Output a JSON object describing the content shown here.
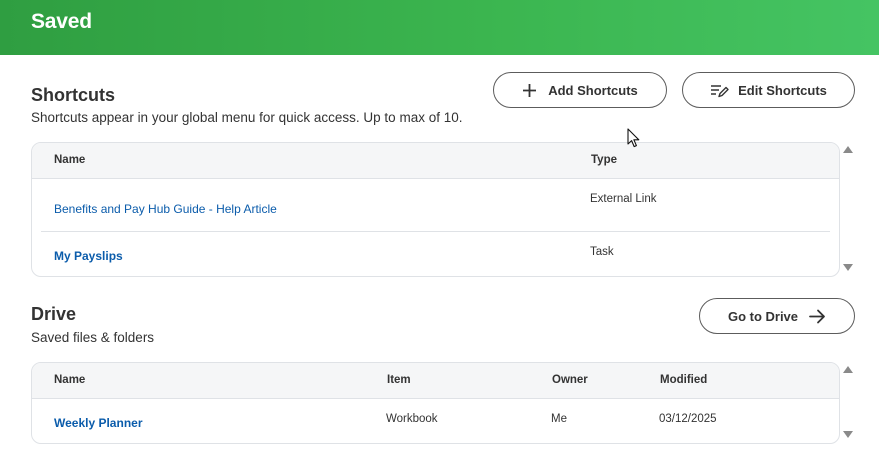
{
  "header": {
    "title": "Saved"
  },
  "shortcuts": {
    "title": "Shortcuts",
    "subtitle": "Shortcuts appear in your global menu for quick access. Up to max of 10.",
    "add_label": "Add Shortcuts",
    "edit_label": "Edit Shortcuts",
    "columns": {
      "name": "Name",
      "type": "Type"
    },
    "rows": [
      {
        "name": "Benefits and Pay Hub Guide - Help Article",
        "type": "External Link"
      },
      {
        "name": "My Payslips",
        "type": "Task"
      }
    ]
  },
  "drive": {
    "title": "Drive",
    "subtitle": "Saved files & folders",
    "goto_label": "Go to Drive",
    "columns": {
      "name": "Name",
      "item": "Item",
      "owner": "Owner",
      "modified": "Modified"
    },
    "rows": [
      {
        "name": "Weekly Planner",
        "item": "Workbook",
        "owner": "Me",
        "modified": "03/12/2025"
      }
    ]
  },
  "colors": {
    "header_green": "#3bb54f",
    "link_blue": "#0b5cab"
  },
  "icons": [
    "plus-icon",
    "edit-list-icon",
    "arrow-right-icon",
    "scroll-up-icon",
    "scroll-down-icon",
    "mouse-cursor-icon"
  ]
}
